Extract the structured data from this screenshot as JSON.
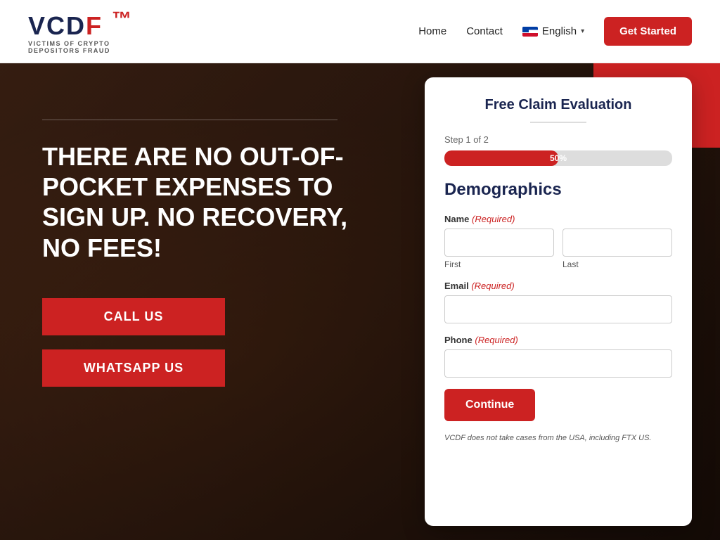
{
  "header": {
    "logo": {
      "main": "VCDF",
      "accent_letter": "F",
      "subtitle_line1": "VICTIMS OF CRYPTO",
      "subtitle_line2": "DEPOSITORS FRAUD"
    },
    "nav": {
      "home_label": "Home",
      "contact_label": "Contact",
      "language_label": "English",
      "get_started_label": "Get Started"
    }
  },
  "hero": {
    "title": "THERE ARE NO OUT-OF-POCKET EXPENSES TO SIGN UP. NO RECOVERY, NO FEES!",
    "call_us_label": "CALL US",
    "whatsapp_label": "WHATSAPP US"
  },
  "form": {
    "title": "Free Claim Evaluation",
    "step_label": "Step 1 of 2",
    "progress_percent": "50%",
    "progress_width": "50%",
    "section_heading": "Demographics",
    "name_label": "Name",
    "name_required": "(Required)",
    "first_label": "First",
    "last_label": "Last",
    "email_label": "Email",
    "email_required": "(Required)",
    "phone_label": "Phone",
    "phone_required": "(Required)",
    "continue_label": "Continue",
    "disclaimer": "VCDF does not take cases from the USA, including FTX US."
  }
}
